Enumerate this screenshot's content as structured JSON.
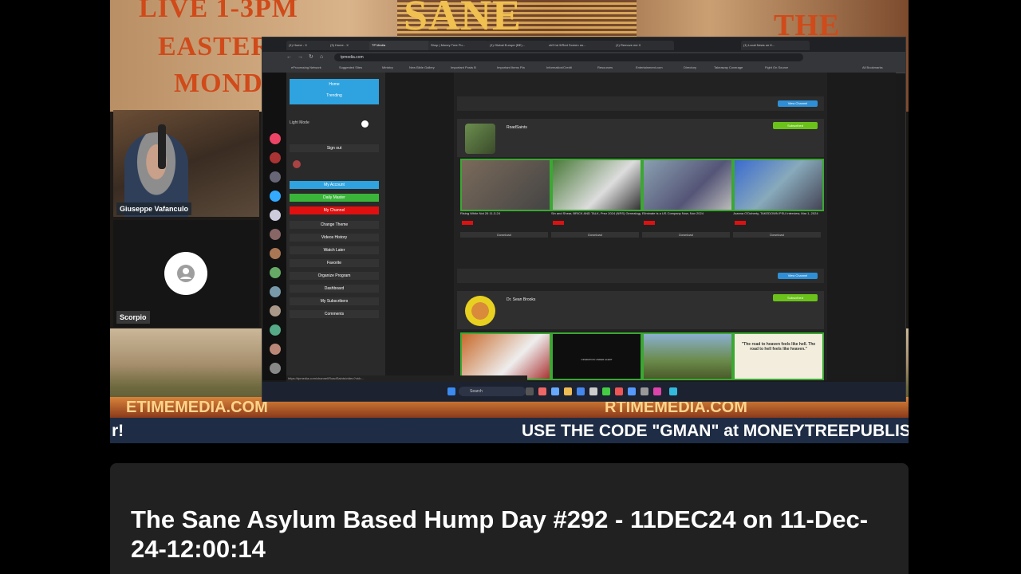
{
  "overlay": {
    "banner_lines": [
      "LIVE 1-3PM",
      "EASTERN",
      "MONDAY"
    ],
    "show_logo": "SANE",
    "banner_right": "THE",
    "url_strip": "ETIMEMEDIA.COM",
    "url_strip_right": "RTIMEMEDIA.COM",
    "ticker_left": "r!",
    "ticker_right": "USE THE CODE \"GMAN\" at MONEYTREEPUBLIS"
  },
  "participants": [
    {
      "name": "Giuseppe Vafanculo"
    },
    {
      "name": "Scorpio"
    }
  ],
  "shared_screen": {
    "tabs": [
      "(1) Home - X",
      "(3) Home - X",
      "TP Media",
      "Shop | Money Tree Pu...",
      "(1) Global Europe (BE)...",
      "ch9 hd 9/Red Screen no...",
      "(1) Remove me X",
      "(1) Local News on K..."
    ],
    "url": "tpmedia.com",
    "bookmarks": [
      "eProcessing Network",
      "Suggested Sites",
      "Ministry",
      "New Bible Gallery",
      "Important Posts B",
      "Important Items Pla",
      "Information/Credit",
      "Resources",
      "Entertainment.com",
      "Directory",
      "Takeaway Coverage",
      "Fight On Source",
      "All Bookmarks"
    ],
    "sidebar": {
      "home": "Home",
      "trending": "Trending",
      "light_mode": "Light Mode",
      "sign_out": "Sign out",
      "items": [
        {
          "label": "My Account",
          "color": "#2ea3e0"
        },
        {
          "label": "Daily Master",
          "color": "#3ab53a"
        },
        {
          "label": "My Channel",
          "color": "#e01010"
        },
        {
          "label": "Change Theme"
        },
        {
          "label": "Videos History"
        },
        {
          "label": "Watch Later"
        },
        {
          "label": "Favorite"
        },
        {
          "label": "Organize Program"
        },
        {
          "label": "Dashboard"
        },
        {
          "label": "My Subscribers"
        },
        {
          "label": "Comments"
        }
      ]
    },
    "channels": [
      {
        "name": "RoadSaints",
        "subscribe": "Subscribed",
        "view_all": "View Channel",
        "videos": [
          {
            "title": "Rising White Not 26 11-3-24",
            "tag": "FREE"
          },
          {
            "title": "Sin and Shear, BRICK AND TALK, Prez 2024 (NRS) Genealogy of Flesh",
            "tag": "FREE"
          },
          {
            "title": "Eliminate is a US Company Now, Nov 2024",
            "tag": "FREE"
          },
          {
            "title": "Joanna O'Doherty, TAKEDOWN PSU Interview, Mar 1, 2024",
            "tag": "FREE"
          }
        ],
        "download": "Download"
      },
      {
        "name": "Dr. Sean Brooks",
        "subscribe": "Subscribed",
        "view_all": "View Channel",
        "thumb_text": [
          "OPERATION UNDER ALERT",
          "\"The road to heaven feels like hell. The road to hell feels like heaven.\""
        ]
      }
    ],
    "status_url": "https://tpmedia.com/channel/RoadSaints/video?vid=...",
    "taskbar_search": "Search"
  },
  "video": {
    "title": "The Sane Asylum Based Hump Day #292 - 11DEC24 on 11-Dec-24-12:00:14"
  }
}
